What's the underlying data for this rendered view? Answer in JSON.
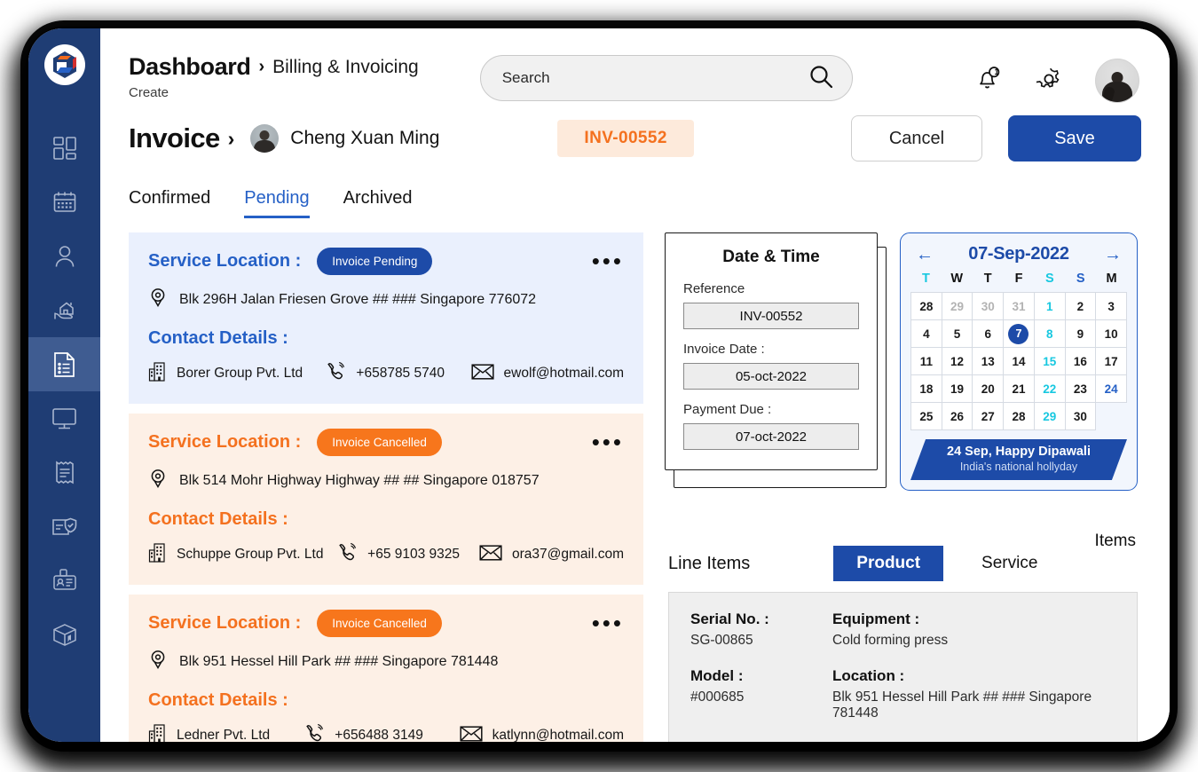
{
  "sidebar": {
    "logo_name": "app-logo",
    "items": [
      {
        "name": "dashboard",
        "icon": "grid-icon",
        "active": false
      },
      {
        "name": "calendar",
        "icon": "calendar-icon",
        "active": false
      },
      {
        "name": "customers",
        "icon": "user-icon",
        "active": false
      },
      {
        "name": "properties",
        "icon": "house-in-hand-icon",
        "active": false
      },
      {
        "name": "billing",
        "icon": "document-list-icon",
        "active": true
      },
      {
        "name": "monitor",
        "icon": "monitor-icon",
        "active": false
      },
      {
        "name": "receipts",
        "icon": "receipt-icon",
        "active": false
      },
      {
        "name": "warranty",
        "icon": "card-shield-icon",
        "active": false
      },
      {
        "name": "id-cards",
        "icon": "id-badge-icon",
        "active": false
      },
      {
        "name": "inventory",
        "icon": "package-box-icon",
        "active": false
      }
    ]
  },
  "header": {
    "breadcrumb_main": "Dashboard",
    "breadcrumb_chevron": "›",
    "breadcrumb_sub": "Billing & Invoicing",
    "breadcrumb_create": "Create",
    "search": {
      "placeholder": "Search",
      "value": "",
      "icon": "search-icon"
    },
    "notifications": {
      "icon": "bell-icon",
      "badge": "1"
    },
    "settings": {
      "icon": "gear-icon"
    },
    "avatar": {
      "name": "user-avatar"
    }
  },
  "invoice": {
    "title": "Invoice",
    "chevron": "›",
    "customer": "Cheng Xuan Ming",
    "number_badge": "INV-00552",
    "cancel_label": "Cancel",
    "save_label": "Save"
  },
  "tabs": [
    {
      "label": "Confirmed",
      "active": false
    },
    {
      "label": "Pending",
      "active": true
    },
    {
      "label": "Archived",
      "active": false
    }
  ],
  "service_cards": [
    {
      "theme": "blue",
      "service_location_label": "Service Location :",
      "status": "Invoice Pending",
      "address": "Blk 296H Jalan Friesen Grove ## ### Singapore 776072",
      "contact_label": "Contact Details :",
      "company": "Borer Group Pvt. Ltd",
      "phone": "+658785 5740",
      "email": "ewolf@hotmail.com"
    },
    {
      "theme": "orange",
      "service_location_label": "Service Location :",
      "status": "Invoice Cancelled",
      "address": "Blk 514 Mohr Highway Highway ## ## Singapore 018757",
      "contact_label": "Contact Details :",
      "company": "Schuppe Group Pvt. Ltd",
      "phone": "+65 9103 9325",
      "email": "ora37@gmail.com"
    },
    {
      "theme": "orange",
      "service_location_label": "Service Location :",
      "status": "Invoice Cancelled",
      "address": "Blk 951 Hessel Hill Park ## ### Singapore 781448",
      "contact_label": "Contact Details :",
      "company": "Ledner Pvt. Ltd",
      "phone": "+656488 3149",
      "email": "katlynn@hotmail.com"
    }
  ],
  "date_time": {
    "title": "Date & Time",
    "reference_label": "Reference",
    "reference_value": "INV-00552",
    "invoice_date_label": "Invoice Date :",
    "invoice_date_value": "05-oct-2022",
    "payment_due_label": "Payment Due :",
    "payment_due_value": "07-oct-2022"
  },
  "calendar": {
    "prev_icon": "arrow-left-icon",
    "next_icon": "arrow-right-icon",
    "month_label": "07-Sep-2022",
    "weekdays": [
      {
        "label": "T",
        "color": "cyan"
      },
      {
        "label": "W",
        "color": "dark"
      },
      {
        "label": "T",
        "color": "dark"
      },
      {
        "label": "F",
        "color": "dark"
      },
      {
        "label": "S",
        "color": "cyan"
      },
      {
        "label": "S",
        "color": "blue"
      },
      {
        "label": "M",
        "color": "dark"
      }
    ],
    "days": [
      {
        "d": "28",
        "style": "normal"
      },
      {
        "d": "29",
        "style": "muted"
      },
      {
        "d": "30",
        "style": "muted"
      },
      {
        "d": "31",
        "style": "muted"
      },
      {
        "d": "1",
        "style": "cyan"
      },
      {
        "d": "2",
        "style": "normal"
      },
      {
        "d": "3",
        "style": "normal"
      },
      {
        "d": "4",
        "style": "normal"
      },
      {
        "d": "5",
        "style": "normal"
      },
      {
        "d": "6",
        "style": "normal"
      },
      {
        "d": "7",
        "style": "selected"
      },
      {
        "d": "8",
        "style": "cyan"
      },
      {
        "d": "9",
        "style": "normal"
      },
      {
        "d": "10",
        "style": "normal"
      },
      {
        "d": "11",
        "style": "normal"
      },
      {
        "d": "12",
        "style": "normal"
      },
      {
        "d": "13",
        "style": "normal"
      },
      {
        "d": "14",
        "style": "normal"
      },
      {
        "d": "15",
        "style": "cyan"
      },
      {
        "d": "16",
        "style": "normal"
      },
      {
        "d": "17",
        "style": "normal"
      },
      {
        "d": "18",
        "style": "normal"
      },
      {
        "d": "19",
        "style": "normal"
      },
      {
        "d": "20",
        "style": "normal"
      },
      {
        "d": "21",
        "style": "normal"
      },
      {
        "d": "22",
        "style": "cyan"
      },
      {
        "d": "23",
        "style": "normal"
      },
      {
        "d": "24",
        "style": "blue"
      },
      {
        "d": "25",
        "style": "normal"
      },
      {
        "d": "26",
        "style": "normal"
      },
      {
        "d": "27",
        "style": "normal"
      },
      {
        "d": "28",
        "style": "normal"
      },
      {
        "d": "29",
        "style": "cyan"
      },
      {
        "d": "30",
        "style": "normal"
      },
      {
        "d": "",
        "style": "empty"
      }
    ],
    "banner_title": "24 Sep, Happy Dipawali",
    "banner_sub": "India's national hollyday"
  },
  "line_items": {
    "items_label": "Items",
    "title": "Line Items",
    "tab_product": "Product",
    "tab_service": "Service",
    "serial_label": "Serial No. :",
    "serial_value": "SG-00865",
    "equipment_label": "Equipment :",
    "equipment_value": "Cold forming press",
    "model_label": "Model :",
    "model_value": "#000685",
    "location_label": "Location :",
    "location_value": "Blk 951 Hessel Hill Park ## ### Singapore 781448"
  },
  "colors": {
    "sidebar": "#1f3d74",
    "primary_blue": "#1d4ba8",
    "link_blue": "#2560c6",
    "orange": "#f4711f",
    "cyan": "#18c8e0",
    "badge_bg": "#fdeadb"
  }
}
